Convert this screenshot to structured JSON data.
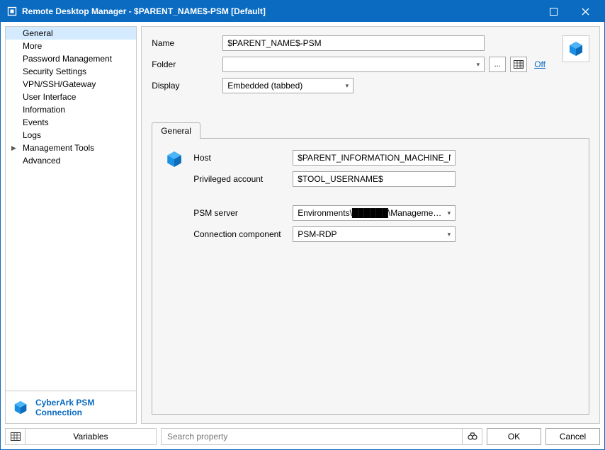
{
  "titlebar": {
    "title": "Remote Desktop Manager - $PARENT_NAME$-PSM [Default]"
  },
  "nav": {
    "items": [
      {
        "label": "General",
        "selected": true
      },
      {
        "label": "More"
      },
      {
        "label": "Password Management"
      },
      {
        "label": "Security Settings"
      },
      {
        "label": "VPN/SSH/Gateway"
      },
      {
        "label": "User Interface"
      },
      {
        "label": "Information"
      },
      {
        "label": "Events"
      },
      {
        "label": "Logs"
      },
      {
        "label": "Management Tools",
        "expandable": true
      },
      {
        "label": "Advanced"
      }
    ]
  },
  "left_footer": {
    "label": "CyberArk PSM Connection"
  },
  "form": {
    "name_label": "Name",
    "name_value": "$PARENT_NAME$-PSM",
    "folder_label": "Folder",
    "folder_value": "",
    "folder_browse": "...",
    "folder_link": "Off",
    "display_label": "Display",
    "display_value": "Embedded (tabbed)"
  },
  "tabs": {
    "items": [
      {
        "label": "General",
        "active": true
      }
    ]
  },
  "detail": {
    "host_label": "Host",
    "host_value": "$PARENT_INFORMATION_MACHINE_NAME$.",
    "privacct_label": "Privileged account",
    "privacct_value": "$TOOL_USERNAME$",
    "psmserver_label": "PSM server",
    "psmserver_value": "Environments\\██████\\Management\\...",
    "conncomp_label": "Connection component",
    "conncomp_value": "PSM-RDP"
  },
  "bottom": {
    "variables_label": "Variables",
    "search_placeholder": "Search property",
    "ok": "OK",
    "cancel": "Cancel"
  }
}
